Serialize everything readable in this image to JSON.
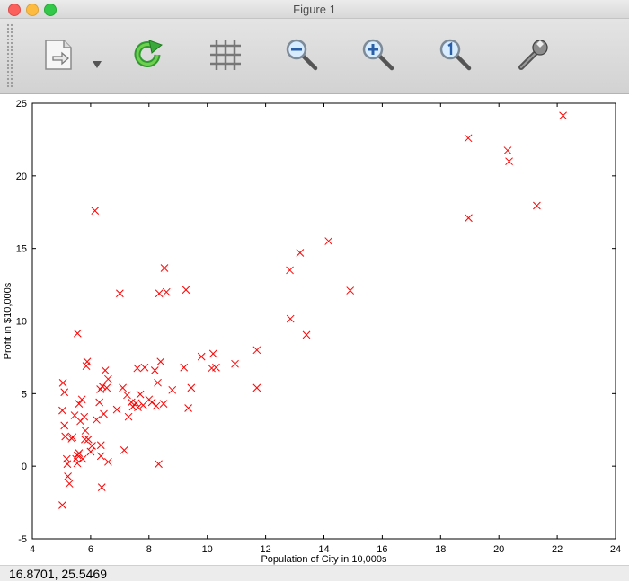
{
  "window": {
    "title": "Figure 1"
  },
  "toolbar": {
    "buttons": [
      {
        "name": "save-icon"
      },
      {
        "name": "refresh-icon"
      },
      {
        "name": "grid-icon"
      },
      {
        "name": "zoom-out-icon"
      },
      {
        "name": "zoom-in-icon"
      },
      {
        "name": "zoom-reset-icon"
      },
      {
        "name": "settings-wrench-icon"
      }
    ]
  },
  "status": {
    "coordinates": "16.8701,  25.5469"
  },
  "colors": {
    "marker": "#ff0000"
  },
  "chart_data": {
    "type": "scatter",
    "title": "",
    "xlabel": "Population of City in 10,000s",
    "ylabel": "Profit in $10,000s",
    "xlim": [
      4,
      24
    ],
    "ylim": [
      -5,
      25
    ],
    "xticks": [
      4,
      6,
      8,
      10,
      12,
      14,
      16,
      18,
      20,
      22,
      24
    ],
    "yticks": [
      -5,
      0,
      5,
      10,
      15,
      20,
      25
    ],
    "marker": "x",
    "grid": false,
    "points": [
      [
        5.03,
        -2.68
      ],
      [
        5.03,
        3.84
      ],
      [
        5.05,
        5.74
      ],
      [
        5.1,
        5.1
      ],
      [
        5.1,
        2.8
      ],
      [
        5.13,
        2.05
      ],
      [
        5.18,
        0.5
      ],
      [
        5.2,
        0.15
      ],
      [
        5.22,
        -0.7
      ],
      [
        5.27,
        -1.2
      ],
      [
        5.35,
        1.9
      ],
      [
        5.38,
        2.0
      ],
      [
        5.45,
        3.5
      ],
      [
        5.5,
        0.5
      ],
      [
        5.54,
        0.2
      ],
      [
        5.55,
        0.75
      ],
      [
        5.6,
        0.9
      ],
      [
        5.55,
        9.15
      ],
      [
        5.6,
        4.3
      ],
      [
        5.65,
        3.1
      ],
      [
        5.7,
        4.6
      ],
      [
        5.73,
        0.5
      ],
      [
        5.78,
        3.4
      ],
      [
        5.8,
        1.85
      ],
      [
        5.82,
        2.45
      ],
      [
        5.85,
        6.9
      ],
      [
        5.88,
        7.2
      ],
      [
        5.92,
        1.85
      ],
      [
        6.0,
        1.0
      ],
      [
        6.05,
        1.4
      ],
      [
        6.15,
        17.6
      ],
      [
        6.2,
        3.2
      ],
      [
        6.3,
        4.4
      ],
      [
        6.33,
        5.3
      ],
      [
        6.35,
        1.45
      ],
      [
        6.35,
        0.7
      ],
      [
        6.38,
        -1.45
      ],
      [
        6.4,
        5.5
      ],
      [
        6.45,
        3.6
      ],
      [
        6.5,
        6.6
      ],
      [
        6.55,
        5.4
      ],
      [
        6.6,
        0.3
      ],
      [
        6.6,
        6.0
      ],
      [
        6.9,
        3.9
      ],
      [
        7.0,
        11.9
      ],
      [
        7.1,
        5.4
      ],
      [
        7.15,
        1.1
      ],
      [
        7.25,
        4.9
      ],
      [
        7.3,
        3.4
      ],
      [
        7.4,
        4.4
      ],
      [
        7.45,
        4.1
      ],
      [
        7.55,
        4.35
      ],
      [
        7.6,
        6.75
      ],
      [
        7.62,
        4.05
      ],
      [
        7.7,
        4.95
      ],
      [
        7.8,
        4.2
      ],
      [
        7.85,
        6.8
      ],
      [
        8.0,
        4.6
      ],
      [
        8.1,
        4.4
      ],
      [
        8.2,
        6.6
      ],
      [
        8.25,
        4.15
      ],
      [
        8.3,
        5.75
      ],
      [
        8.33,
        0.15
      ],
      [
        8.35,
        11.9
      ],
      [
        8.4,
        7.2
      ],
      [
        8.5,
        4.3
      ],
      [
        8.53,
        13.65
      ],
      [
        8.6,
        12.0
      ],
      [
        8.8,
        5.25
      ],
      [
        9.2,
        6.8
      ],
      [
        9.27,
        12.15
      ],
      [
        9.35,
        4.0
      ],
      [
        9.45,
        5.4
      ],
      [
        9.8,
        7.55
      ],
      [
        10.15,
        6.75
      ],
      [
        10.2,
        7.75
      ],
      [
        10.3,
        6.8
      ],
      [
        10.95,
        7.05
      ],
      [
        11.7,
        8.0
      ],
      [
        11.7,
        5.4
      ],
      [
        12.83,
        13.5
      ],
      [
        12.85,
        10.15
      ],
      [
        13.18,
        14.7
      ],
      [
        13.4,
        9.05
      ],
      [
        14.16,
        15.5
      ],
      [
        14.9,
        12.1
      ],
      [
        18.95,
        22.6
      ],
      [
        18.96,
        17.1
      ],
      [
        20.3,
        21.75
      ],
      [
        20.35,
        21.0
      ],
      [
        21.3,
        17.95
      ],
      [
        22.2,
        24.15
      ]
    ]
  }
}
